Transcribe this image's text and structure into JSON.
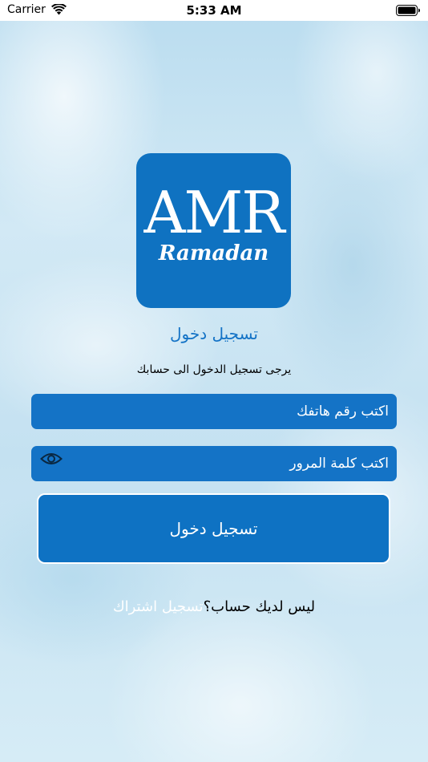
{
  "status_bar": {
    "carrier": "Carrier",
    "time": "5:33 AM",
    "icons": [
      "wifi-icon",
      "battery-icon"
    ]
  },
  "logo": {
    "letters": "AMR",
    "script": "Ramadan"
  },
  "login": {
    "title": "تسجيل دخول",
    "subtitle": "يرجى تسجيل الدخول الى حسابك",
    "phone_placeholder": "اكتب رقم هاتفك",
    "phone_value": "",
    "password_placeholder": "اكتب كلمة المرور",
    "password_value": "",
    "password_toggle_icon": "eye-icon",
    "submit_label": "تسجيل دخول",
    "signup_prompt": "ليس لديك حساب؟",
    "signup_link": "تسجيل اشتراك"
  },
  "colors": {
    "primary": "#1473c6",
    "button": "#0e72c3",
    "logo_background": "#0f72c1",
    "text_on_primary": "#ffffff"
  }
}
